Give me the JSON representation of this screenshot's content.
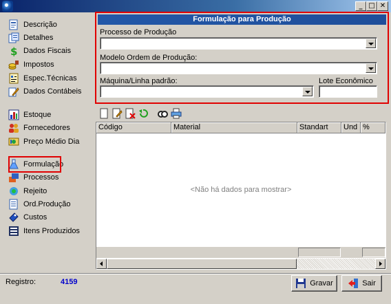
{
  "window": {
    "controls": {
      "minimize": "_",
      "maximize": "□",
      "close": "✕"
    }
  },
  "sidebar": {
    "items": [
      {
        "label": "Descrição",
        "icon": "document-icon"
      },
      {
        "label": "Detalhes",
        "icon": "details-icon"
      },
      {
        "label": "Dados Fiscais",
        "icon": "dollar-icon"
      },
      {
        "label": "Impostos",
        "icon": "coins-icon"
      },
      {
        "label": "Espec.Técnicas",
        "icon": "specs-icon"
      },
      {
        "label": "Dados Contábeis",
        "icon": "pencil-icon"
      },
      {
        "label": "Estoque",
        "icon": "chart-icon"
      },
      {
        "label": "Fornecedores",
        "icon": "suppliers-icon"
      },
      {
        "label": "Preço Médio Dia",
        "icon": "price-icon"
      },
      {
        "label": "Formulação",
        "icon": "flask-icon",
        "selected": true
      },
      {
        "label": "Processos",
        "icon": "process-icon"
      },
      {
        "label": "Rejeito",
        "icon": "reject-icon"
      },
      {
        "label": "Ord.Produção",
        "icon": "order-icon"
      },
      {
        "label": "Custos",
        "icon": "costs-icon"
      },
      {
        "label": "Itens Produzidos",
        "icon": "items-icon"
      }
    ]
  },
  "panel": {
    "title": "Formulação para Produção",
    "processo_label": "Processo de Produção",
    "processo_value": "",
    "modelo_label": "Modelo Ordem de Produção:",
    "modelo_value": "",
    "maquina_label": "Máquina/Linha padrão:",
    "maquina_value": "",
    "lote_label": "Lote Econômico",
    "lote_value": ""
  },
  "toolbar": {
    "buttons": [
      "new-icon",
      "edit-icon",
      "delete-icon",
      "undo-icon",
      "search-icon",
      "print-icon"
    ]
  },
  "grid": {
    "columns": [
      "Código",
      "Material",
      "Standart",
      "Und",
      "%"
    ],
    "empty_message": "<Não há dados para mostrar>"
  },
  "footer": {
    "registro_label": "Registro:",
    "registro_value": "4159",
    "gravar_label": "Gravar",
    "sair_label": "Sair"
  },
  "colors": {
    "title_bar": "#0a246a",
    "panel_header": "#2358a8",
    "highlight_border": "#e00000",
    "record_number": "#0000cc"
  }
}
